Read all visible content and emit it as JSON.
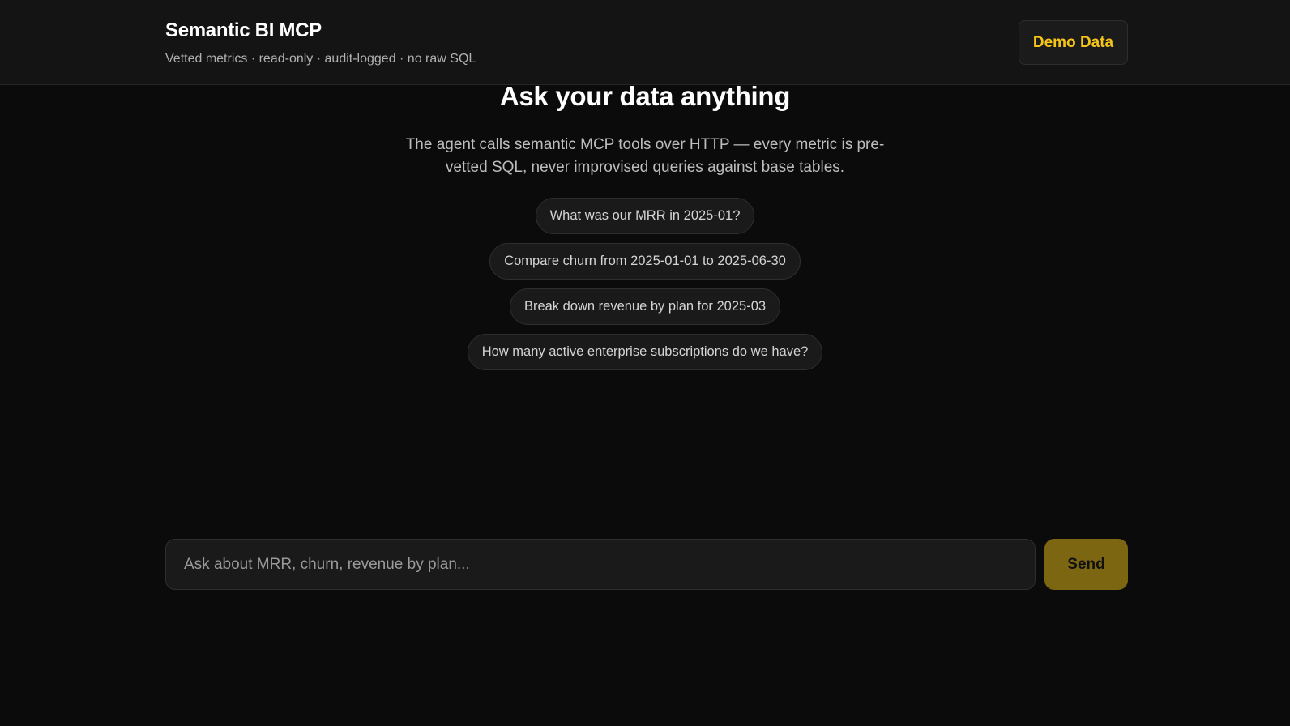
{
  "header": {
    "title": "Semantic BI MCP",
    "subtitle": "Vetted metrics · read-only · audit-logged · no raw SQL",
    "demo_button_label": "Demo Data"
  },
  "hero": {
    "title": "Ask your data anything",
    "description": "The agent calls semantic MCP tools over HTTP — every metric is pre-vetted SQL, never improvised queries against base tables."
  },
  "suggestions": [
    "What was our MRR in 2025-01?",
    "Compare churn from 2025-01-01 to 2025-06-30",
    "Break down revenue by plan for 2025-03",
    "How many active enterprise subscriptions do we have?"
  ],
  "composer": {
    "value": "",
    "placeholder": "Ask about MRR, churn, revenue by plan...",
    "send_label": "Send"
  },
  "colors": {
    "accent": "#f5c518",
    "send_button": "#7d6612",
    "background": "#0b0b0b",
    "header_background": "#141414"
  }
}
